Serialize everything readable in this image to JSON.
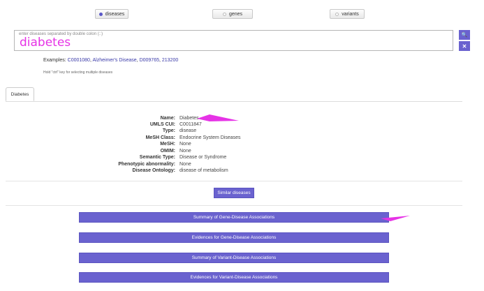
{
  "selector": {
    "diseases": "diseases",
    "genes": "genes",
    "variants": "variants",
    "selected": "diseases"
  },
  "search": {
    "placeholder": "enter diseases separated by double colon (::)",
    "value": "diabetes",
    "search_icon": "search-icon",
    "clear_icon": "close-icon",
    "search_glyph": "🔍",
    "clear_glyph": "✕"
  },
  "examples": {
    "prefix": "Examples:",
    "items": [
      "C0001080",
      "Alzheimer's Disease",
      "D009765",
      "213200"
    ]
  },
  "hint": "Hold \"ctrl\" key for selecting multiple diseases",
  "tab": {
    "label": "Diabetes"
  },
  "disease_info": [
    {
      "label": "Name:",
      "value": "Diabetes"
    },
    {
      "label": "UMLS CUI:",
      "value": "C0011847"
    },
    {
      "label": "Type:",
      "value": "disease"
    },
    {
      "label": "MeSH Class:",
      "value": "Endocrine System Diseases"
    },
    {
      "label": "MeSH:",
      "value": "None"
    },
    {
      "label": "OMIM:",
      "value": "None"
    },
    {
      "label": "Semantic Type:",
      "value": "Disease or Syndrome"
    },
    {
      "label": "Phenotypic abnormality:",
      "value": "None"
    },
    {
      "label": "Disease Ontology:",
      "value": "disease of metabolism"
    }
  ],
  "buttons": {
    "similar": "Similar diseases",
    "actions": [
      "Summary of Gene-Disease Associations",
      "Evidences for Gene-Disease Associations",
      "Summary of Variant-Disease Associations",
      "Evidences for Variant-Disease Associations"
    ]
  },
  "colors": {
    "accent": "#6a62cf",
    "annotation": "#e633e6"
  }
}
